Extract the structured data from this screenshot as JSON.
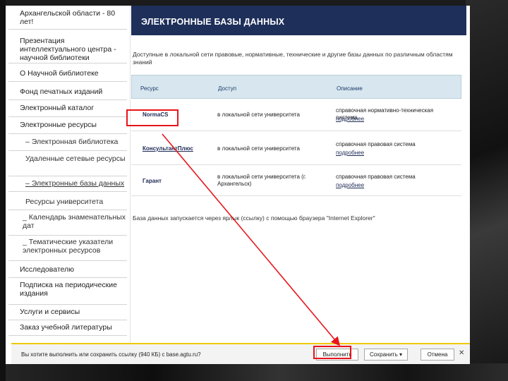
{
  "sidebar": {
    "items": [
      {
        "label": "Архангельской области - 80 лет!",
        "sub": false
      },
      {
        "label": "Презентация интеллектуального центра - научной библиотеки",
        "sub": false
      },
      {
        "label": "О Научной библиотеке",
        "sub": false
      },
      {
        "label": "Фонд печатных изданий",
        "sub": false
      },
      {
        "label": "Электронный каталог",
        "sub": false
      },
      {
        "label": "Электронные ресурсы",
        "sub": false
      },
      {
        "label": "– Электронная библиотека",
        "sub": true
      },
      {
        "label": "Удаленные сетевые ресурсы",
        "sub": true
      },
      {
        "label": "– Электронные базы данных",
        "sub": true
      },
      {
        "label": "Ресурсы университета",
        "sub": true
      },
      {
        "label": "_ Календарь знаменательных дат",
        "sub": true
      },
      {
        "label": "_ Тематические указатели электронных ресурсов",
        "sub": true
      },
      {
        "label": "Исследователю",
        "sub": false
      },
      {
        "label": "Подписка на периодические издания",
        "sub": false
      },
      {
        "label": "Услуги и сервисы",
        "sub": false
      },
      {
        "label": "Заказ учебной литературы",
        "sub": false
      }
    ]
  },
  "banner": {
    "title": "ЭЛЕКТРОННЫЕ БАЗЫ ДАННЫХ"
  },
  "intro": "Доступные в локальной сети правовые, нормативные, технические и другие базы данных по различным областям знаний",
  "table": {
    "headers": [
      "Ресурс",
      "Доступ",
      "Описание"
    ],
    "rows": [
      {
        "resource": "NormaCS",
        "access": "в локальной сети университета",
        "desc": "справочная нормативно-техническая система",
        "more": "подробнее"
      },
      {
        "resource": "КонсультантПлюс",
        "access": "в локальной сети университета",
        "desc": "справочная правовая система",
        "more": "подробнее"
      },
      {
        "resource": "Гарант",
        "access": "в локальной сети университета (г. Архангельск)",
        "desc": "справочная правовая система",
        "more": "подробнее"
      }
    ]
  },
  "note": "База данных запускается через ярлык (ссылку) с помощью браузера \"Internet Explorer\"",
  "download_bar": {
    "message": "Вы хотите выполнить или сохранить ссылку (940 КБ) с base.agtu.ru?",
    "run_label": "Выполнить",
    "save_label": "Сохранить",
    "save_arrow": "▾",
    "cancel_label": "Отмена",
    "close_glyph": "✕"
  },
  "annotation_color": "#e8141c",
  "header_color": "#1e2f5a"
}
